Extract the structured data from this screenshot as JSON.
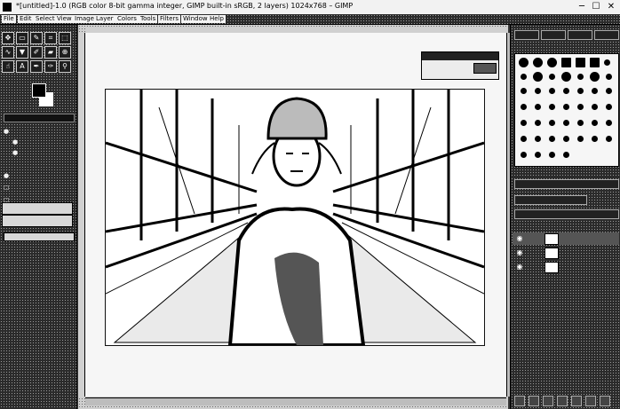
{
  "window": {
    "title": "*[untitled]-1.0 (RGB color 8-bit gamma integer, GIMP built-in sRGB, 2 layers) 1024x768 – GIMP",
    "minimize": "─",
    "maximize": "☐",
    "close": "✕"
  },
  "menubar": {
    "items": [
      "File",
      "Edit",
      "Select",
      "View",
      "Image",
      "Layer",
      "Colors",
      "Tools",
      "Filters",
      "Windows",
      "Help"
    ]
  },
  "toolbox": {
    "tools": [
      {
        "icon": "move-icon",
        "glyph": "✥"
      },
      {
        "icon": "rect-select-icon",
        "glyph": "▭"
      },
      {
        "icon": "free-select-icon",
        "glyph": "✎"
      },
      {
        "icon": "crop-icon",
        "glyph": "⌗"
      },
      {
        "icon": "unified-transform-icon",
        "glyph": "⬚"
      },
      {
        "icon": "warp-icon",
        "glyph": "∿"
      },
      {
        "icon": "paint-bucket-icon",
        "glyph": "▼"
      },
      {
        "icon": "paintbrush-icon",
        "glyph": "✐"
      },
      {
        "icon": "eraser-icon",
        "glyph": "▰"
      },
      {
        "icon": "clone-icon",
        "glyph": "⊕"
      },
      {
        "icon": "smudge-icon",
        "glyph": "☝"
      },
      {
        "icon": "text-icon",
        "glyph": "A"
      },
      {
        "icon": "path-icon",
        "glyph": "✒"
      },
      {
        "icon": "color-picker-icon",
        "glyph": "✑"
      },
      {
        "icon": "zoom-icon",
        "glyph": "⚲"
      }
    ],
    "fg_color": "#000000",
    "bg_color": "#ffffff"
  },
  "brushes": {
    "tabs": [
      "",
      "",
      "",
      ""
    ]
  },
  "layers": {
    "rows": [
      {
        "visible": true,
        "name": ""
      },
      {
        "visible": true,
        "name": ""
      },
      {
        "visible": true,
        "name": ""
      }
    ]
  }
}
